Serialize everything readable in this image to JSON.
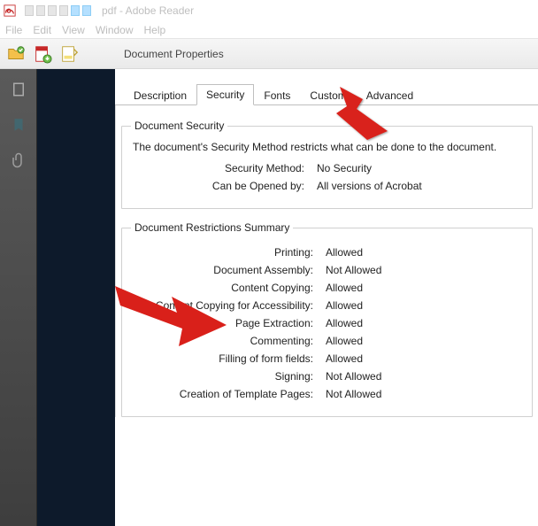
{
  "window": {
    "title": "pdf - Adobe Reader"
  },
  "menu": {
    "file": "File",
    "edit": "Edit",
    "view": "View",
    "window": "Window",
    "help": "Help"
  },
  "properties": {
    "dialog_title": "Document Properties",
    "tabs": {
      "description": "Description",
      "security": "Security",
      "fonts": "Fonts",
      "custom": "Custom",
      "advanced": "Advanced"
    },
    "security": {
      "group_title": "Document Security",
      "description": "The document's Security Method restricts what can be done to the document.",
      "method_label": "Security Method:",
      "method_value": "No Security",
      "opened_label": "Can be Opened by:",
      "opened_value": "All versions of Acrobat"
    },
    "restrictions": {
      "group_title": "Document Restrictions Summary",
      "rows": [
        {
          "label": "Printing:",
          "value": "Allowed"
        },
        {
          "label": "Document Assembly:",
          "value": "Not Allowed"
        },
        {
          "label": "Content Copying:",
          "value": "Allowed"
        },
        {
          "label": "Content Copying for Accessibility:",
          "value": "Allowed"
        },
        {
          "label": "Page Extraction:",
          "value": "Allowed"
        },
        {
          "label": "Commenting:",
          "value": "Allowed"
        },
        {
          "label": "Filling of form fields:",
          "value": "Allowed"
        },
        {
          "label": "Signing:",
          "value": "Not Allowed"
        },
        {
          "label": "Creation of Template Pages:",
          "value": "Not Allowed"
        }
      ]
    }
  }
}
